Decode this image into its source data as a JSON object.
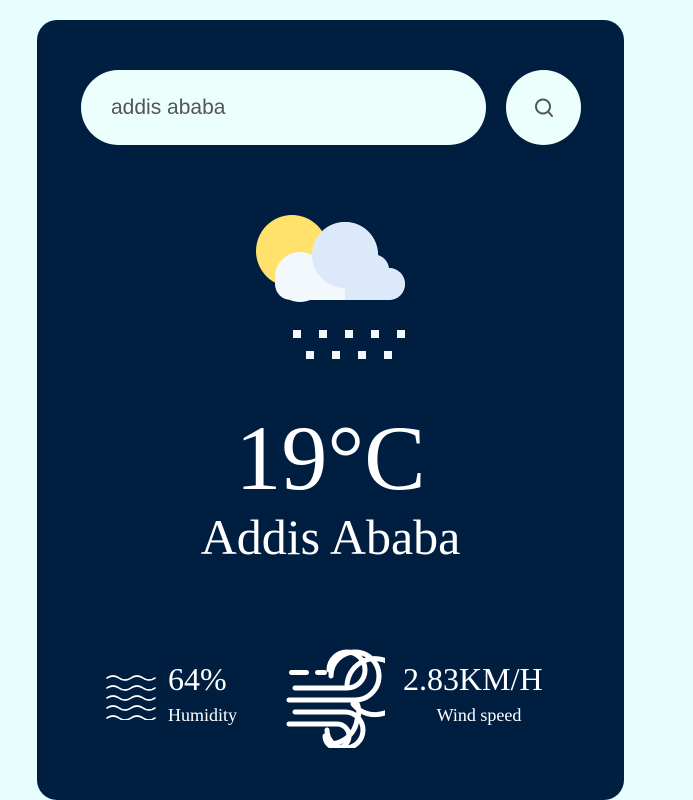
{
  "search": {
    "value": "addis ababa",
    "button_icon": "search-icon"
  },
  "weather": {
    "icon": "snow-cloud-sun-icon",
    "temperature": "19°C",
    "city": "Addis Ababa"
  },
  "details": {
    "humidity_icon": "humidity-waves-icon",
    "humidity_value": "64%",
    "humidity_label": "Humidity",
    "wind_icon": "wind-icon",
    "wind_value": "2.83KM/H",
    "wind_label": "Wind speed"
  },
  "colors": {
    "page_background": "#e6fffe",
    "card_background": "#001e40",
    "input_background": "#ebfffd",
    "sun": "#ffe16b",
    "cloud": "#f3f8fd",
    "cloud_shade": "#dbe9fb",
    "text": "#ffffff"
  }
}
